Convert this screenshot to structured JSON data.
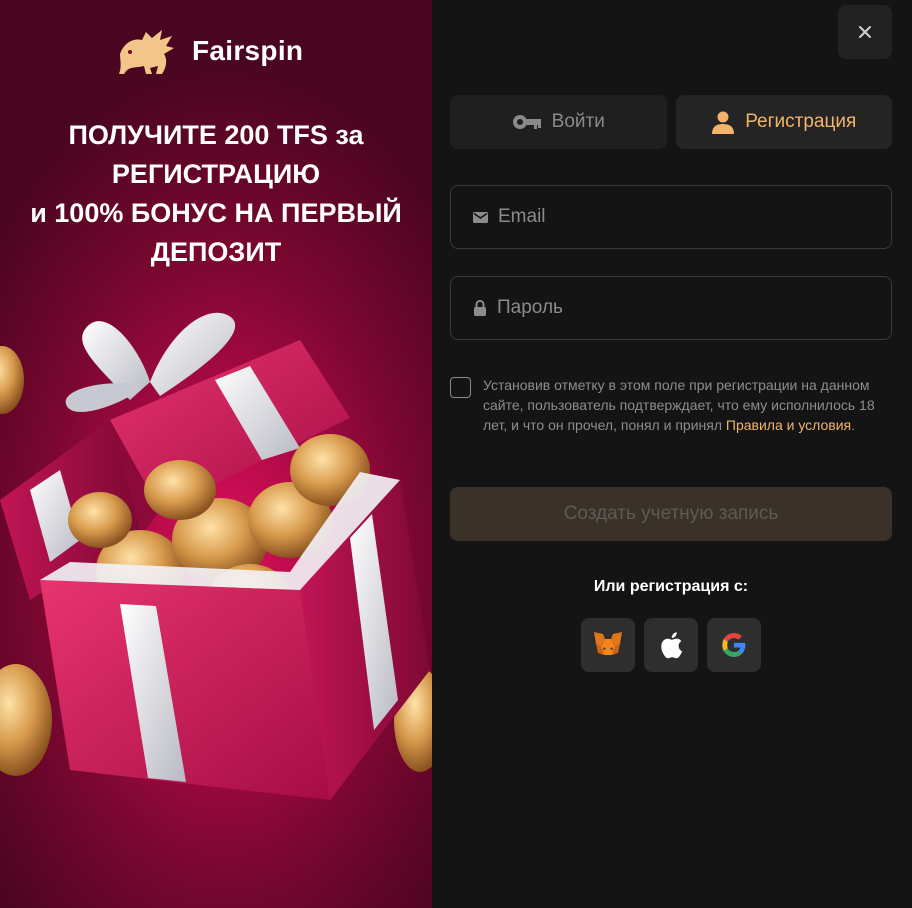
{
  "promo": {
    "brand_name": "Fairspin",
    "headline_lines": [
      "ПОЛУЧИТЕ 200 TFS за",
      "РЕГИСТРАЦИЮ",
      "и 100% БОНУС НА ПЕРВЫЙ",
      "ДЕПОЗИТ"
    ]
  },
  "tabs": [
    {
      "label": "Войти",
      "icon": "key-icon",
      "active": false
    },
    {
      "label": "Регистрация",
      "icon": "user-icon",
      "active": true
    }
  ],
  "fields": {
    "email": {
      "placeholder": "Email",
      "value": "",
      "icon": "mail-icon"
    },
    "password": {
      "placeholder": "Пароль",
      "value": "",
      "icon": "lock-icon"
    }
  },
  "consent": {
    "checked": false,
    "text": "Установив отметку в этом поле при регистрации на данном сайте, пользователь подтверждает, что ему исполнилось 18 лет, и что он прочел, понял и принял ",
    "link_text": "Правила и условия",
    "suffix": "."
  },
  "create_button": {
    "label": "Создать учетную запись"
  },
  "social": {
    "title": "Или регистрация с:",
    "providers": [
      {
        "name": "metamask",
        "icon": "metamask-fox-icon"
      },
      {
        "name": "apple",
        "icon": "apple-icon"
      },
      {
        "name": "google",
        "icon": "google-icon"
      }
    ]
  },
  "close_icon": "close-icon",
  "colors": {
    "accent": "#f2b36b",
    "panel_bg": "#141414",
    "promo_bg": "#b00a48",
    "button_disabled": "#3a3128"
  }
}
